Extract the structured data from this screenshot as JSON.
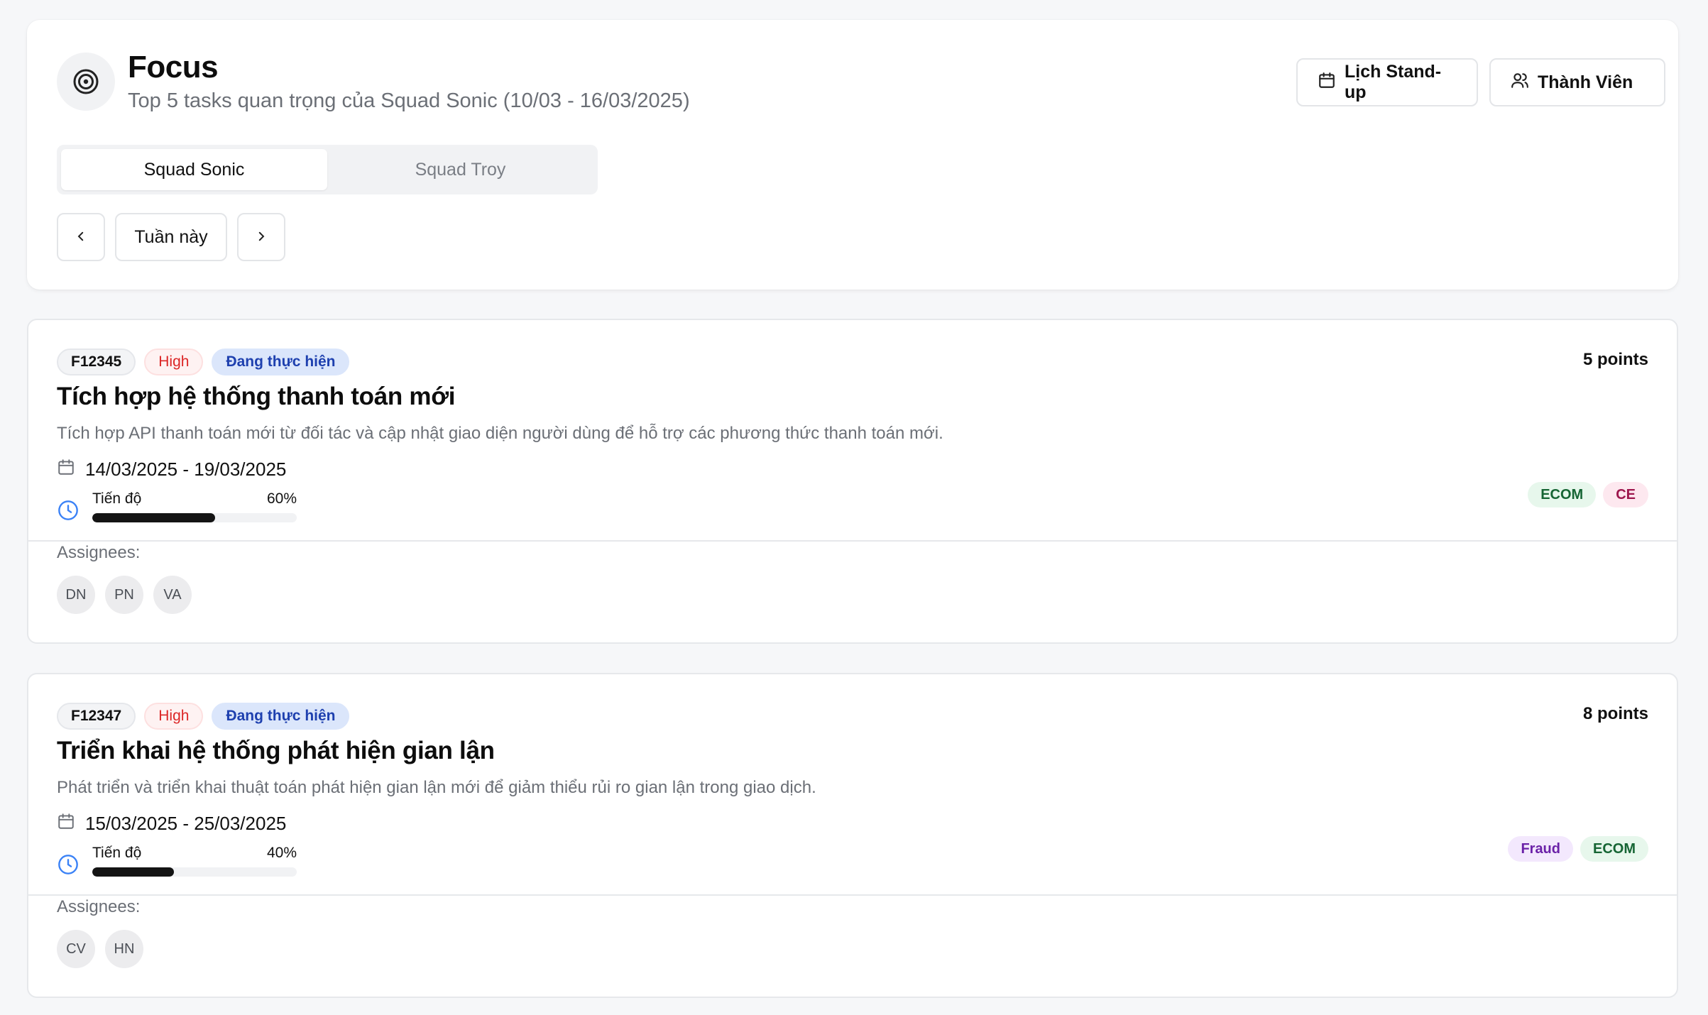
{
  "header": {
    "title": "Focus",
    "subtitle": "Top 5 tasks quan trọng của Squad Sonic (10/03 - 16/03/2025)",
    "standup_label": "Lịch Stand-up",
    "members_label": "Thành Viên",
    "icon": "target-icon"
  },
  "squad_tabs": [
    {
      "label": "Squad Sonic",
      "active": true
    },
    {
      "label": "Squad Troy",
      "active": false
    }
  ],
  "week_nav": {
    "current_label": "Tuần này"
  },
  "tasks": [
    {
      "id": "F12345",
      "priority": "High",
      "status": "Đang thực hiện",
      "points": "5 points",
      "title": "Tích hợp hệ thống thanh toán mới",
      "description": "Tích hợp API thanh toán mới từ đối tác và cập nhật giao diện người dùng để hỗ trợ các phương thức thanh toán mới.",
      "date_range": "14/03/2025 - 19/03/2025",
      "progress_label": "Tiến độ",
      "progress_text": "60%",
      "progress": 0.6,
      "tags": [
        "ECOM",
        "CE"
      ],
      "assignees_label": "Assignees:",
      "assignees": [
        "DN",
        "PN",
        "VA"
      ]
    },
    {
      "id": "F12347",
      "priority": "High",
      "status": "Đang thực hiện",
      "points": "8 points",
      "title": "Triển khai hệ thống phát hiện gian lận",
      "description": "Phát triển và triển khai thuật toán phát hiện gian lận mới để giảm thiểu rủi ro gian lận trong giao dịch.",
      "date_range": "15/03/2025 - 25/03/2025",
      "progress_label": "Tiến độ",
      "progress_text": "40%",
      "progress": 0.4,
      "tags": [
        "Fraud",
        "ECOM"
      ],
      "assignees_label": "Assignees:",
      "assignees": [
        "CV",
        "HN"
      ]
    }
  ],
  "colors": {
    "background": "#f6f7f9",
    "priority_high": "#dc2626",
    "status_in_progress": "#1e40af",
    "clock_icon": "#3b82f6",
    "progress_fill": "#141414"
  }
}
